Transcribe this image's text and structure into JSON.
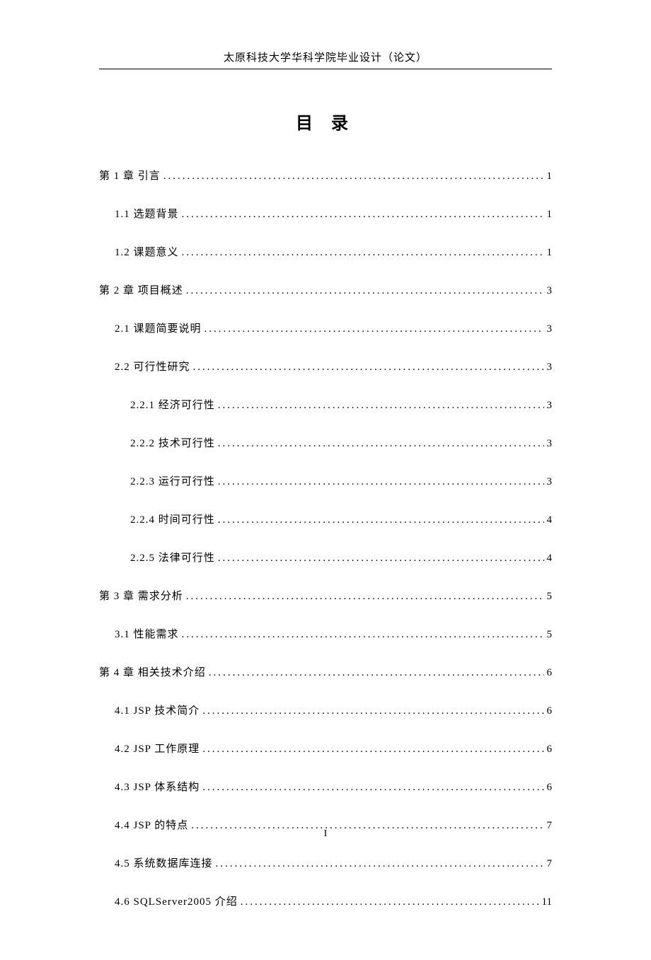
{
  "header": "太原科技大学华科学院毕业设计（论文）",
  "title": "目 录",
  "pageNumber": "I",
  "toc": [
    {
      "label": "第 1 章 引言",
      "page": "1",
      "indent": 0
    },
    {
      "label": "1.1 选题背景 ",
      "page": "1",
      "indent": 1
    },
    {
      "label": "1.2 课题意义 ",
      "page": "1",
      "indent": 1
    },
    {
      "label": "第 2 章 项目概述",
      "page": "3",
      "indent": 0
    },
    {
      "label": "2.1 课题简要说明",
      "page": "3",
      "indent": 1
    },
    {
      "label": "2.2 可行性研究",
      "page": "3",
      "indent": 1
    },
    {
      "label": "2.2.1 经济可行性 ",
      "page": "3",
      "indent": 2
    },
    {
      "label": "2.2.2 技术可行性 ",
      "page": "3",
      "indent": 2
    },
    {
      "label": "2.2.3 运行可行性 ",
      "page": "3",
      "indent": 2
    },
    {
      "label": "2.2.4 时间可行性",
      "page": "4",
      "indent": 2
    },
    {
      "label": "2.2.5 法律可行性",
      "page": "4",
      "indent": 2
    },
    {
      "label": "第 3 章 需求分析",
      "page": "5",
      "indent": 0
    },
    {
      "label": "3.1 性能需求",
      "page": "5",
      "indent": 1
    },
    {
      "label": "第 4 章 相关技术介绍",
      "page": "6",
      "indent": 0
    },
    {
      "label": "4.1 JSP 技术简介 ",
      "page": "6",
      "indent": 1
    },
    {
      "label": "4.2 JSP 工作原理 ",
      "page": "6",
      "indent": 1
    },
    {
      "label": "4.3 JSP 体系结构 ",
      "page": "6",
      "indent": 1
    },
    {
      "label": "4.4 JSP 的特点 ",
      "page": "7",
      "indent": 1
    },
    {
      "label": "4.5 系统数据库连接",
      "page": "7",
      "indent": 1
    },
    {
      "label": "4.6 SQLServer2005 介绍 ",
      "page": "11",
      "indent": 1
    }
  ]
}
